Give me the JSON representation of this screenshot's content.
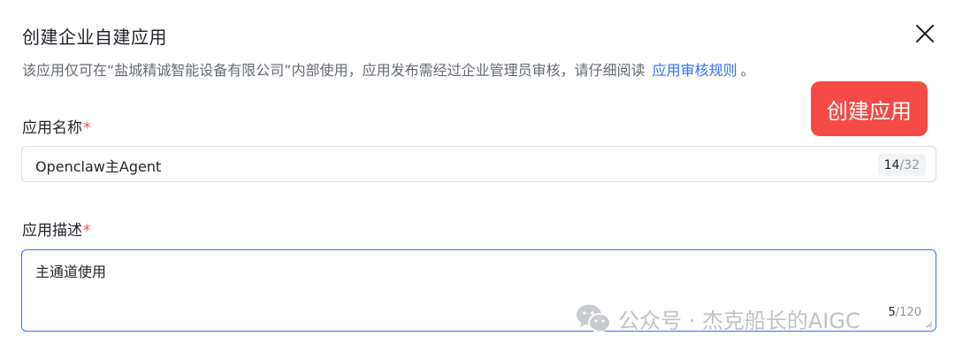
{
  "dialog": {
    "title": "创建企业自建应用",
    "notice": "该应用仅可在“盐城精诚智能设备有限公司”内部使用，应用发布需经过企业管理员审核，请仔细阅读",
    "notice_link": "应用审核规则",
    "notice_period": "。"
  },
  "actions": {
    "create_label": "创建应用"
  },
  "form": {
    "name": {
      "label": "应用名称",
      "required_mark": "*",
      "value": "Openclaw主Agent",
      "count": "14",
      "max": "/32"
    },
    "description": {
      "label": "应用描述",
      "required_mark": "*",
      "value": "主通道使用",
      "count": "5",
      "max": "/120"
    }
  },
  "watermark": {
    "text": "公众号 · 杰克船长的AIGC",
    "icon": "wechat-icon"
  },
  "colors": {
    "accent": "#3370ff",
    "danger": "#f54a45",
    "text": "#1f2329",
    "muted": "#646a73",
    "border": "#dee0e3"
  }
}
